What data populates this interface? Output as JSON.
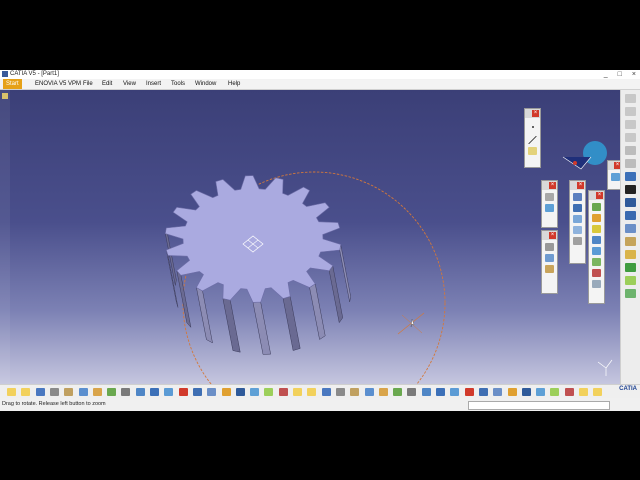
{
  "window": {
    "title": "CATIA V5 - [Part1]"
  },
  "window_buttons": [
    "_",
    "□",
    "×"
  ],
  "menu": {
    "items": [
      "Start",
      "ENOVIA V5 VPM",
      "File",
      "Edit",
      "View",
      "Insert",
      "Tools",
      "Window",
      "Help"
    ]
  },
  "status": {
    "text": "Drag to rotate. Release left button to zoom"
  },
  "brand": {
    "logo_text": "CATIA"
  },
  "colors": {
    "accent": "#e6a117",
    "viewport_top": "#3b3f77",
    "viewport_bottom": "#c5c6df",
    "gear_face": "#aaaae0",
    "circle": "#d4783a"
  }
}
